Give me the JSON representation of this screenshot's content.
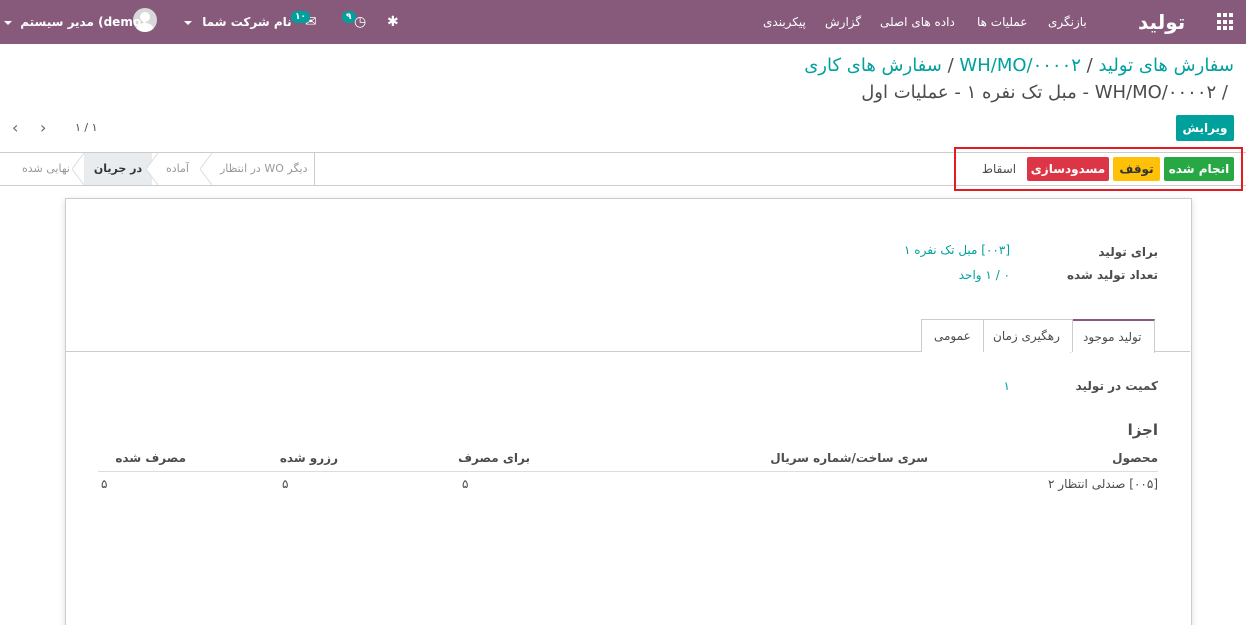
{
  "navbar": {
    "brand": "تولید",
    "menu": [
      "بازنگری",
      "عملیات ها",
      "داده های اصلی",
      "گزارش",
      "پیکربندی"
    ],
    "company": "نام شرکت شما",
    "user": "مدیر سیستم (demo)",
    "messages_badge": "۱۰",
    "activities_badge": "۹"
  },
  "breadcrumb": {
    "root": "سفارش های تولید",
    "mo": "WH/MO/۰۰۰۰۲",
    "workorders": "سفارش های کاری",
    "sep": "/",
    "current": "WH/MO/۰۰۰۰۲ - مبل تک نفره ۱ - عملیات اول"
  },
  "control": {
    "edit_label": "ویرایش",
    "pager": "۱ / ۱"
  },
  "actions": {
    "done": "انجام شده",
    "pause": "توقف",
    "block": "مسدودسازی",
    "scrap": "اسقاط",
    "colors": {
      "done": "#28a745",
      "pause": "#ffc107",
      "block": "#dc3545",
      "highlight": "#e31b23"
    }
  },
  "stages": [
    "نهایی شده",
    "در جریان",
    "آماده",
    "در انتظار WO دیگر"
  ],
  "form": {
    "to_produce_label": "برای تولید",
    "to_produce_value": "[۰۰۳] مبل تک نفره ۱",
    "produced_label": "تعداد تولید شده",
    "produced_value": "۰ / ۱ واحد",
    "tabs": [
      "تولید موجود",
      "رهگیری زمان",
      "عمومی"
    ],
    "qty_label": "کمیت در تولید",
    "qty_value": "۱",
    "components_title": "اجزا"
  },
  "table": {
    "headers": [
      "محصول",
      "سری ساخت/شماره سریال",
      "برای مصرف",
      "رزرو شده",
      "مصرف شده"
    ],
    "rows": [
      {
        "product": "[۰۰۵] صندلی انتظار ۲",
        "to_consume": "۵",
        "reserved": "۵",
        "consumed": "۵"
      }
    ]
  }
}
